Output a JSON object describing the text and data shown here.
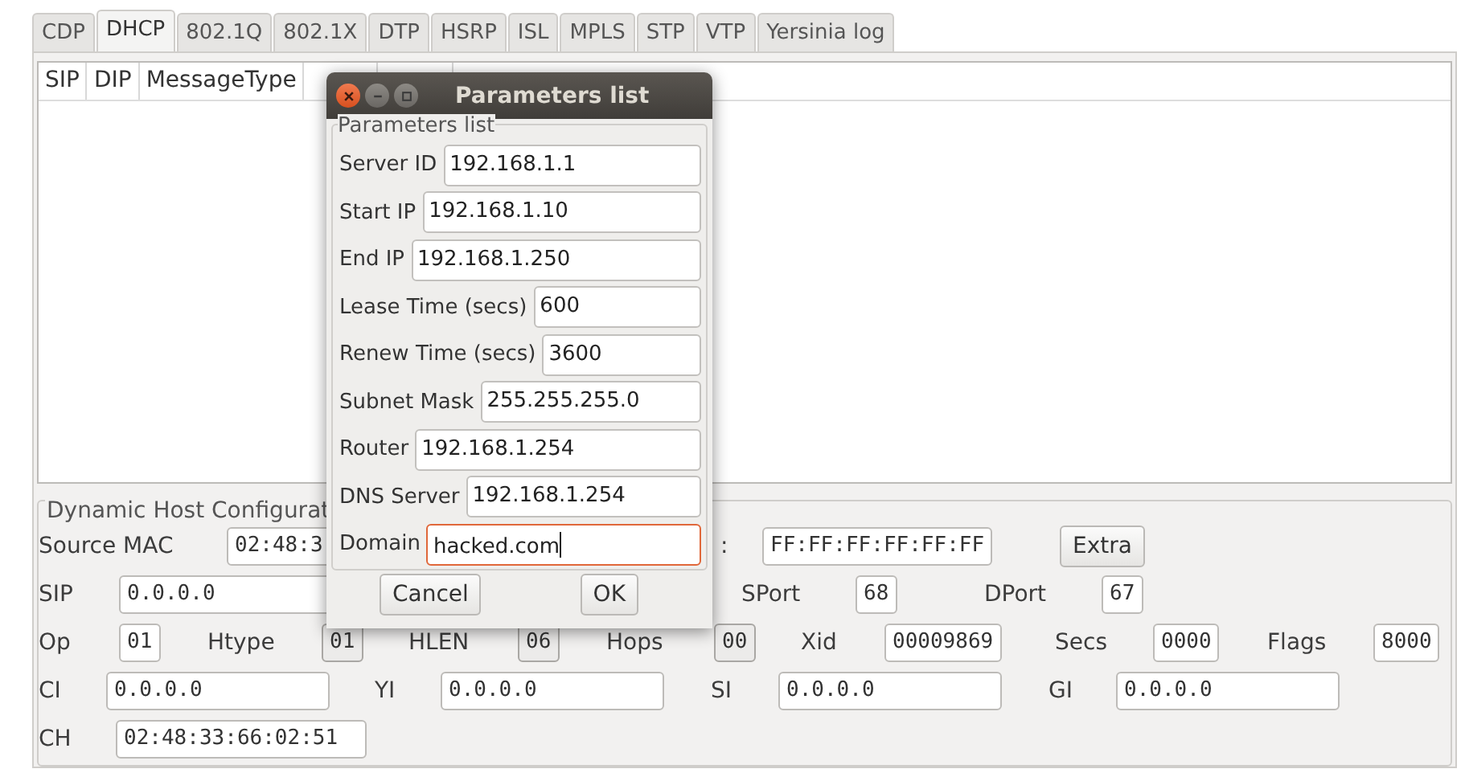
{
  "tabs": [
    {
      "label": "CDP",
      "selected": false
    },
    {
      "label": "DHCP",
      "selected": true
    },
    {
      "label": "802.1Q",
      "selected": false
    },
    {
      "label": "802.1X",
      "selected": false
    },
    {
      "label": "DTP",
      "selected": false
    },
    {
      "label": "HSRP",
      "selected": false
    },
    {
      "label": "ISL",
      "selected": false
    },
    {
      "label": "MPLS",
      "selected": false
    },
    {
      "label": "STP",
      "selected": false
    },
    {
      "label": "VTP",
      "selected": false
    },
    {
      "label": "Yersinia log",
      "selected": false
    }
  ],
  "table": {
    "columns": [
      "SIP",
      "DIP",
      "MessageType"
    ]
  },
  "form": {
    "title": "Dynamic Host Configurat",
    "rows": [
      {
        "items": [
          {
            "kind": "label",
            "text": "Source MAC"
          },
          {
            "kind": "field",
            "value": "02:48:3",
            "disabled": false
          },
          {
            "kind": "label",
            "text": ":"
          },
          {
            "kind": "field",
            "value": "FF:FF:FF:FF:FF:FF",
            "disabled": false
          },
          {
            "kind": "button",
            "text": "Extra"
          }
        ]
      },
      {
        "items": [
          {
            "kind": "label",
            "text": "SIP"
          },
          {
            "kind": "field",
            "value": "0.0.0.0",
            "disabled": false
          },
          {
            "kind": "label",
            "text": "SPort"
          },
          {
            "kind": "field",
            "value": "68",
            "disabled": false
          },
          {
            "kind": "label",
            "text": "DPort"
          },
          {
            "kind": "field",
            "value": "67",
            "disabled": false
          }
        ]
      },
      {
        "items": [
          {
            "kind": "label",
            "text": "Op"
          },
          {
            "kind": "field",
            "value": "01",
            "disabled": false
          },
          {
            "kind": "label",
            "text": "Htype"
          },
          {
            "kind": "field",
            "value": "01",
            "disabled": true
          },
          {
            "kind": "label",
            "text": "HLEN"
          },
          {
            "kind": "field",
            "value": "06",
            "disabled": true
          },
          {
            "kind": "label",
            "text": "Hops"
          },
          {
            "kind": "field",
            "value": "00",
            "disabled": true
          },
          {
            "kind": "label",
            "text": "Xid"
          },
          {
            "kind": "field",
            "value": "00009869",
            "disabled": false
          },
          {
            "kind": "label",
            "text": "Secs"
          },
          {
            "kind": "field",
            "value": "0000",
            "disabled": false
          },
          {
            "kind": "label",
            "text": "Flags"
          },
          {
            "kind": "field",
            "value": "8000",
            "disabled": false
          }
        ]
      },
      {
        "items": [
          {
            "kind": "label",
            "text": "CI"
          },
          {
            "kind": "field",
            "value": "0.0.0.0",
            "disabled": false
          },
          {
            "kind": "label",
            "text": "YI"
          },
          {
            "kind": "field",
            "value": "0.0.0.0",
            "disabled": false
          },
          {
            "kind": "label",
            "text": "SI"
          },
          {
            "kind": "field",
            "value": "0.0.0.0",
            "disabled": false
          },
          {
            "kind": "label",
            "text": "GI"
          },
          {
            "kind": "field",
            "value": "0.0.0.0",
            "disabled": false
          }
        ]
      },
      {
        "items": [
          {
            "kind": "label",
            "text": "CH"
          },
          {
            "kind": "field",
            "value": "02:48:33:66:02:51",
            "disabled": false
          }
        ]
      }
    ]
  },
  "dialog": {
    "title": "Parameters list",
    "frame_title": "Parameters list",
    "params": [
      {
        "label": "Server ID",
        "value": "192.168.1.1",
        "focused": false
      },
      {
        "label": "Start IP",
        "value": "192.168.1.10",
        "focused": false
      },
      {
        "label": "End IP",
        "value": "192.168.1.250",
        "focused": false
      },
      {
        "label": "Lease Time (secs)",
        "value": "600",
        "focused": false
      },
      {
        "label": "Renew Time (secs)",
        "value": "3600",
        "focused": false
      },
      {
        "label": "Subnet Mask",
        "value": "255.255.255.0",
        "focused": false
      },
      {
        "label": "Router",
        "value": "192.168.1.254",
        "focused": false
      },
      {
        "label": "DNS Server",
        "value": "192.168.1.254",
        "focused": false
      },
      {
        "label": "Domain",
        "value": "hacked.com",
        "focused": true
      }
    ],
    "buttons": [
      "Cancel",
      "OK"
    ]
  }
}
